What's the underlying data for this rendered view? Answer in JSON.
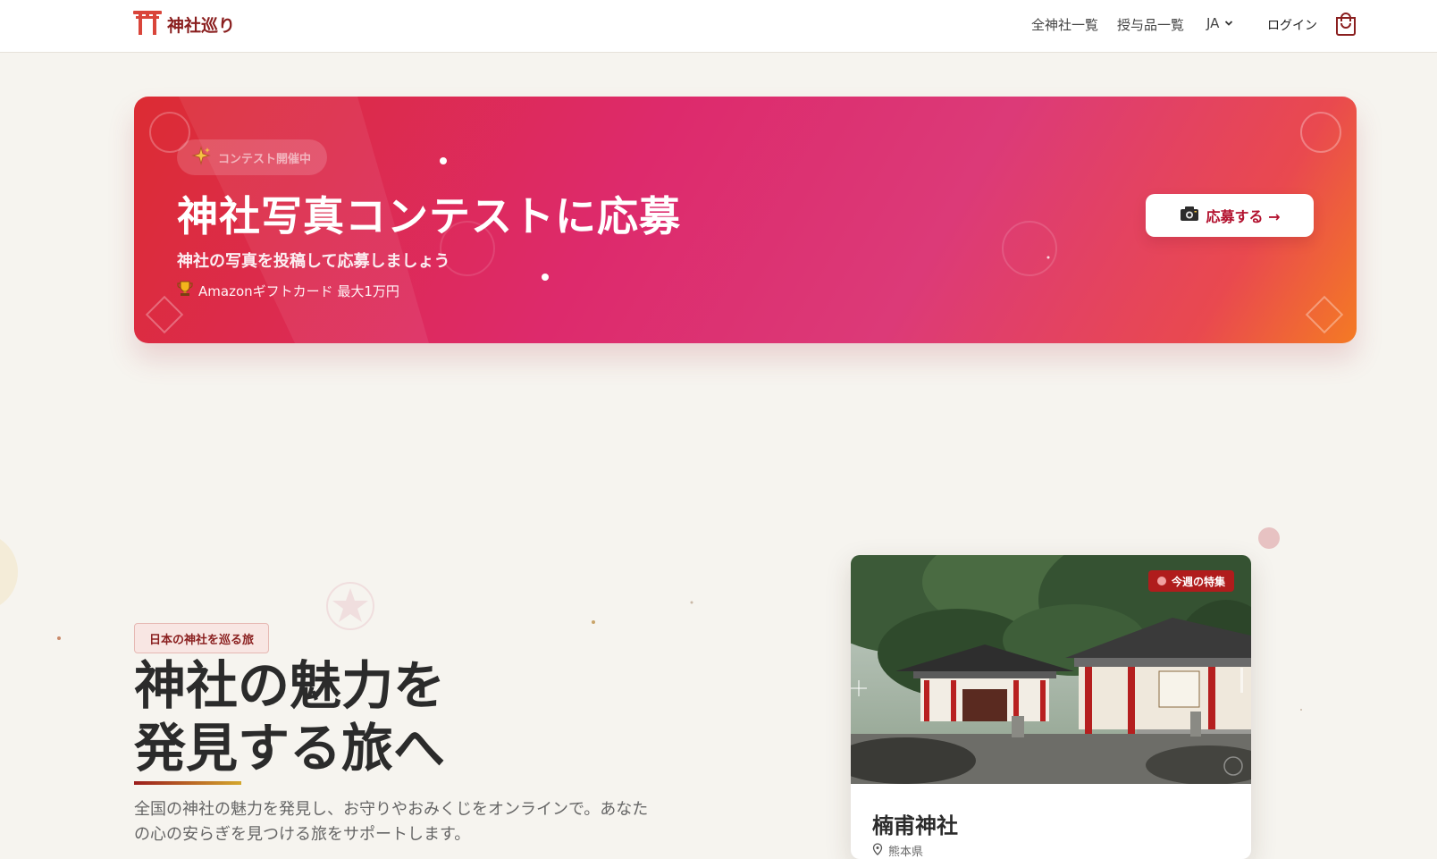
{
  "header": {
    "brand": "神社巡り",
    "nav": {
      "all_shrines": "全神社一覧",
      "all_items": "授与品一覧",
      "language": "JA",
      "login": "ログイン"
    },
    "icons": {
      "logo": "torii-icon",
      "language_dropdown": "chevron-down-icon",
      "cart": "shopping-bag-icon"
    }
  },
  "banner": {
    "badge": "コンテスト開催中",
    "title": "神社写真コンテストに応募",
    "subtitle": "神社の写真を投稿して応募しましょう",
    "prize": "Amazonギフトカード 最大1万円",
    "apply_button": "応募する →",
    "icons": {
      "badge": "sparkle-icon",
      "prize": "trophy-icon",
      "apply": "camera-icon"
    },
    "colors": {
      "start": "#dc2c33",
      "middle": "#dd2a6c",
      "end": "#f47a24"
    }
  },
  "hero": {
    "badge": "日本の神社を巡る旅",
    "title_line1": "神社の魅力を",
    "title_line2": "発見する旅へ",
    "description": "全国の神社の魅力を発見し、お守りやおみくじをオンラインで。あなたの心の安らぎを見つける旅をサポートします。"
  },
  "featured": {
    "badge": "今週の特集",
    "name": "楠甫神社",
    "location": "熊本県",
    "icons": {
      "location": "map-pin-icon"
    }
  },
  "colors": {
    "brand_red": "#8a1f1f",
    "page_background": "#f6f4ef",
    "badge_red": "#b01c1c"
  }
}
